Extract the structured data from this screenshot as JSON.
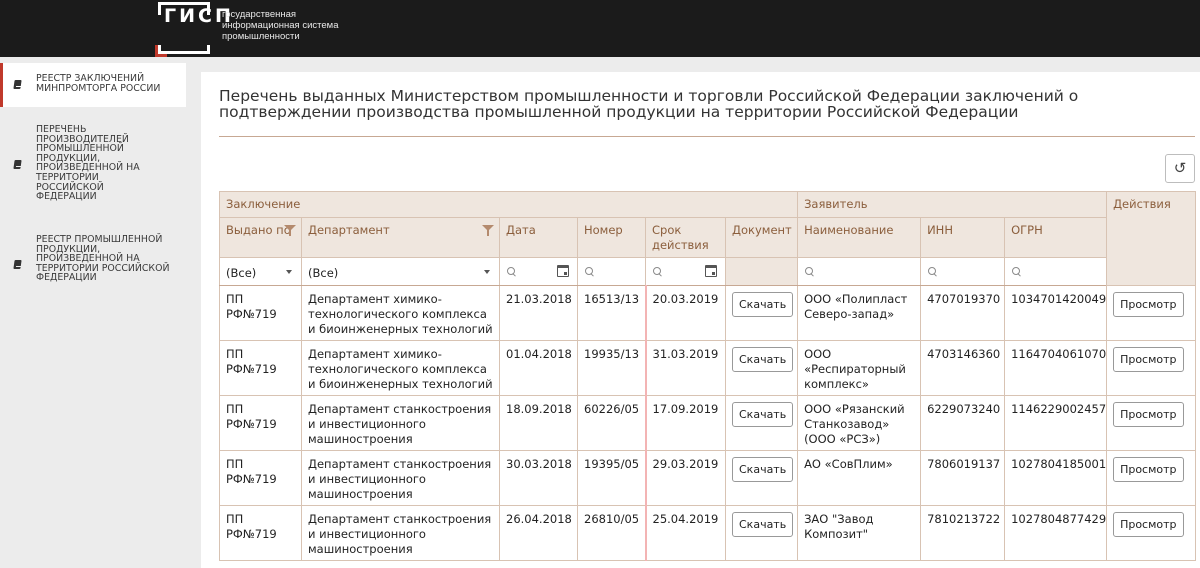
{
  "header": {
    "logo_text": "ГИСП",
    "tagline": [
      "государственная",
      "информационная система",
      "промышленности"
    ]
  },
  "sidebar": {
    "items": [
      {
        "label": "РЕЕСТР ЗАКЛЮЧЕНИЙ МИНПРОМТОРГА РОССИИ",
        "active": true
      },
      {
        "label": "ПЕРЕЧЕНЬ ПРОИЗВОДИТЕЛЕЙ ПРОМЫШЛЕННОЙ ПРОДУКЦИИ, ПРОИЗВЕДЕННОЙ НА ТЕРРИТОРИИ РОССИЙСКОЙ ФЕДЕРАЦИИ",
        "active": false
      },
      {
        "label": "РЕЕСТР ПРОМЫШЛЕННОЙ ПРОДУКЦИИ, ПРОИЗВЕДЕННОЙ НА ТЕРРИТОРИИ РОССИЙСКОЙ ФЕДЕРАЦИИ",
        "active": false
      }
    ]
  },
  "page": {
    "title": "Перечень выданных Министерством промышленности и торговли Российской Федерации заключений о подтверждении производства промышленной продукции на территории Российской Федерации"
  },
  "table": {
    "groups": {
      "conclusion": "Заключение",
      "applicant": "Заявитель",
      "actions": "Действия"
    },
    "columns": {
      "issued_by": "Выдано по",
      "department": "Департамент",
      "date": "Дата",
      "number": "Номер",
      "validity": "Срок действия",
      "document": "Документ",
      "name": "Наименование",
      "inn": "ИНН",
      "ogrn": "ОГРН"
    },
    "filters": {
      "issued_by": "(Все)",
      "department": "(Все)"
    },
    "download_label": "Скачать",
    "view_label": "Просмотр",
    "rows": [
      {
        "issued_by": "ПП РФ№719",
        "department": "Департамент химико-технологического комплекса и биоинженерных технологий",
        "date": "21.03.2018",
        "number": "16513/13",
        "validity": "20.03.2019",
        "name": "ООО «Полипласт Северо-запад»",
        "inn": "4707019370",
        "ogrn": "1034701420049"
      },
      {
        "issued_by": "ПП РФ№719",
        "department": "Департамент химико-технологического комплекса и биоинженерных технологий",
        "date": "01.04.2018",
        "number": "19935/13",
        "validity": "31.03.2019",
        "name": "ООО «Респираторный комплекс»",
        "inn": "4703146360",
        "ogrn": "1164704061070"
      },
      {
        "issued_by": "ПП РФ№719",
        "department": "Департамент станкостроения и инвестиционного машиностроения",
        "date": "18.09.2018",
        "number": "60226/05",
        "validity": "17.09.2019",
        "name": "ООО «Рязанский Станкозавод» (ООО «РСЗ»)",
        "inn": "6229073240",
        "ogrn": "1146229002457"
      },
      {
        "issued_by": "ПП РФ№719",
        "department": "Департамент станкостроения и инвестиционного машиностроения",
        "date": "30.03.2018",
        "number": "19395/05",
        "validity": "29.03.2019",
        "name": "АО «СовПлим»",
        "inn": "7806019137",
        "ogrn": "1027804185001"
      },
      {
        "issued_by": "ПП РФ№719",
        "department": "Департамент станкостроения и инвестиционного машиностроения",
        "date": "26.04.2018",
        "number": "26810/05",
        "validity": "25.04.2019",
        "name": "ЗАО \"Завод Композит\"",
        "inn": "7810213722",
        "ogrn": "1027804877429"
      }
    ]
  },
  "colors": {
    "accent": "#c0392b",
    "header_bg": "#1b1b1b",
    "table_header_bg": "#efe6de",
    "table_header_text": "#8b5e3c"
  }
}
